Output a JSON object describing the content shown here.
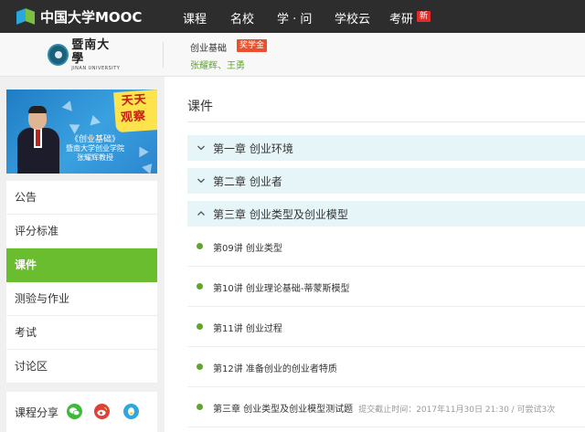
{
  "topnav": {
    "logo_text": "中国大学MOOC",
    "items": [
      "课程",
      "名校",
      "学 · 问",
      "学校云",
      "考研"
    ],
    "new_badge": "新"
  },
  "course_header": {
    "school_name_cn": "暨南大學",
    "school_name_en": "JINAN UNIVERSITY",
    "course_title": "创业基础",
    "award_badge": "奖学金",
    "teachers": "张耀辉、王勇"
  },
  "sidebar": {
    "banner": {
      "title_chars": [
        "天",
        "天",
        "观",
        "察"
      ],
      "caption_line1": "《创业基础》",
      "caption_line2": "暨南大学创业学院",
      "caption_line3": "张耀辉教授"
    },
    "menu": [
      {
        "label": "公告",
        "active": false
      },
      {
        "label": "评分标准",
        "active": false
      },
      {
        "label": "课件",
        "active": true
      },
      {
        "label": "测验与作业",
        "active": false
      },
      {
        "label": "考试",
        "active": false
      },
      {
        "label": "讨论区",
        "active": false
      }
    ],
    "share_label": "课程分享",
    "share_icons": [
      "wechat-icon",
      "weibo-icon",
      "qq-icon"
    ]
  },
  "main": {
    "title": "课件",
    "chapters": [
      {
        "label": "第一章 创业环境",
        "expanded": false
      },
      {
        "label": "第二章 创业者",
        "expanded": false
      },
      {
        "label": "第三章 创业类型及创业模型",
        "expanded": true
      }
    ],
    "lessons": [
      {
        "label": "第09讲 创业类型",
        "meta": ""
      },
      {
        "label": "第10讲 创业理论基础-蒂蒙斯模型",
        "meta": ""
      },
      {
        "label": "第11讲 创业过程",
        "meta": ""
      },
      {
        "label": "第12讲 准备创业的创业者特质",
        "meta": ""
      },
      {
        "label": "第三章 创业类型及创业模型测试题",
        "meta": "提交截止时间：2017年11月30日 21:30 / 可尝试3次"
      }
    ]
  },
  "colors": {
    "topnav_bg": "#2d2d2d",
    "accent_green": "#6abd2e",
    "chapter_bg": "#e6f5f8",
    "badge_red": "#e52a2a",
    "award_orange": "#e8502e"
  }
}
